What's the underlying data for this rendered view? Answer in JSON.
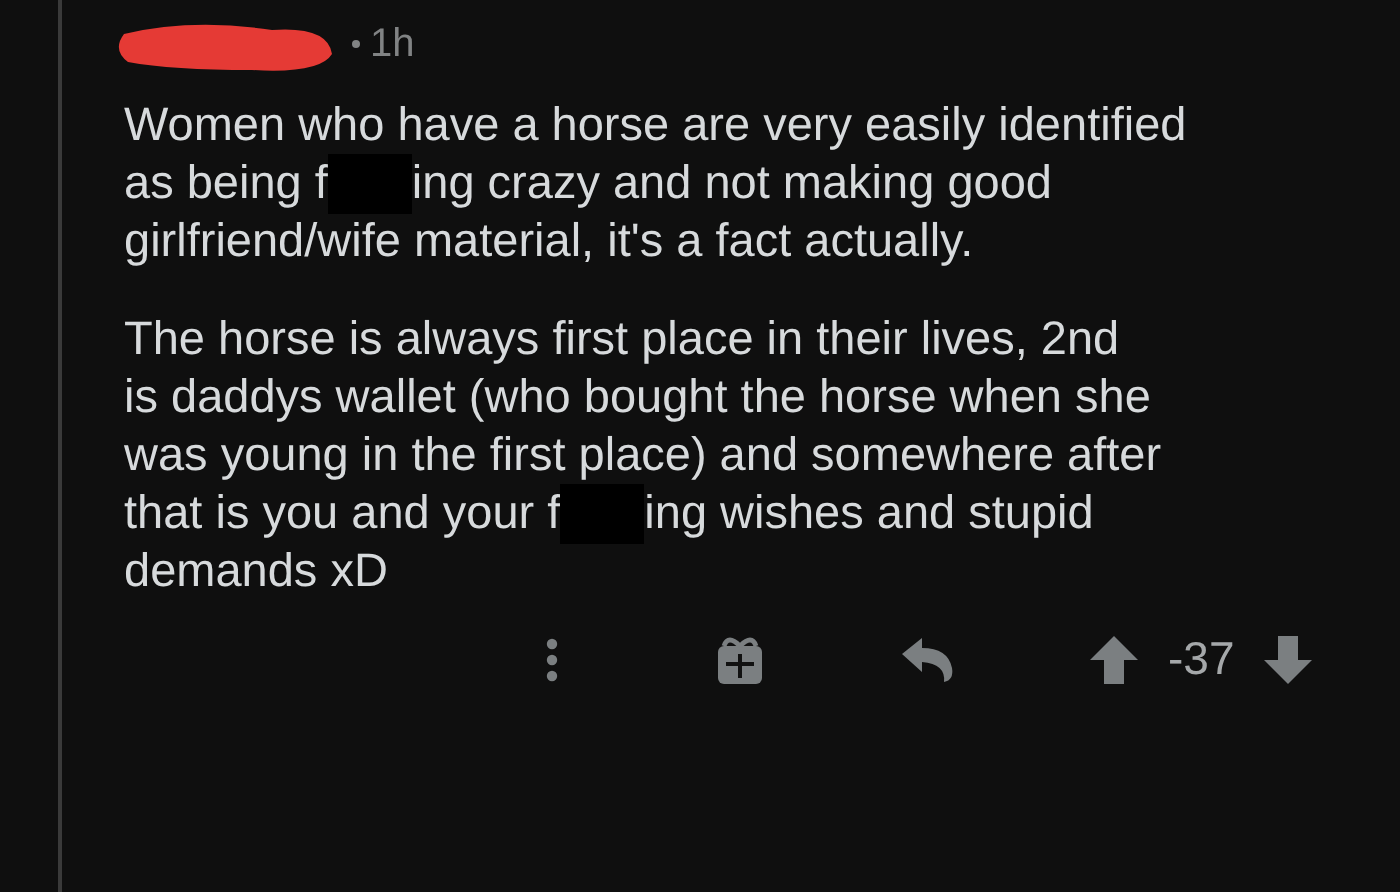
{
  "comment": {
    "username_redacted": true,
    "time": "1h",
    "paragraphs": [
      {
        "lines": [
          [
            {
              "kind": "text",
              "text": "Women who have a horse are very easily identified"
            }
          ],
          [
            {
              "kind": "text",
              "text": "as being f"
            },
            {
              "kind": "redaction"
            },
            {
              "kind": "text",
              "text": "ing crazy and not making good"
            }
          ],
          [
            {
              "kind": "text",
              "text": "girlfriend/wife material, it's a fact actually."
            }
          ]
        ]
      },
      {
        "lines": [
          [
            {
              "kind": "text",
              "text": "The horse is always first place in their lives, 2nd"
            }
          ],
          [
            {
              "kind": "text",
              "text": "is daddys wallet (who bought the horse when she"
            }
          ],
          [
            {
              "kind": "text",
              "text": "was young in the first place) and somewhere after"
            }
          ],
          [
            {
              "kind": "text",
              "text": "that is you and your f"
            },
            {
              "kind": "redaction"
            },
            {
              "kind": "text",
              "text": "ing wishes and stupid"
            }
          ],
          [
            {
              "kind": "text",
              "text": "demands xD"
            }
          ]
        ]
      }
    ],
    "score": "-37"
  }
}
